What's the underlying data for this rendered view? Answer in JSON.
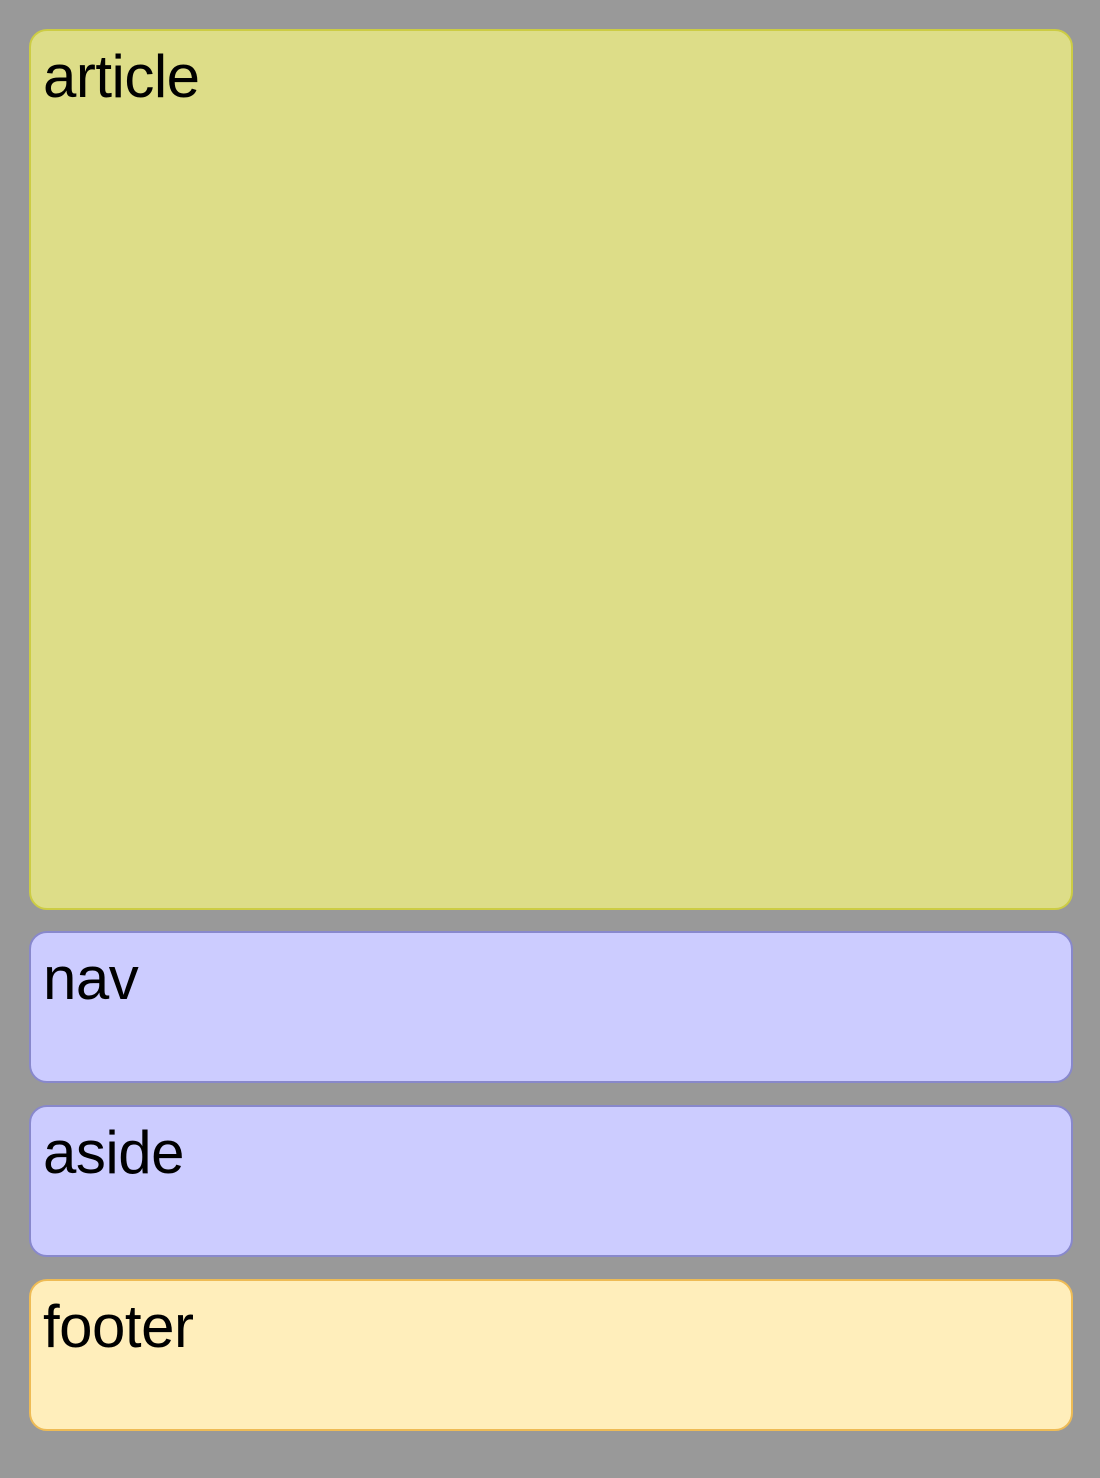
{
  "colors": {
    "page_background": "#999999",
    "article_fill": "#dddd88",
    "article_border": "#cccc44",
    "nav_fill": "#ccccff",
    "nav_border": "#8888cc",
    "aside_fill": "#ccccff",
    "aside_border": "#8888cc",
    "footer_fill": "#ffeebb",
    "footer_border": "#eebb55"
  },
  "article": {
    "label": "article"
  },
  "nav": {
    "label": "nav"
  },
  "aside": {
    "label": "aside"
  },
  "footer": {
    "label": "footer"
  }
}
